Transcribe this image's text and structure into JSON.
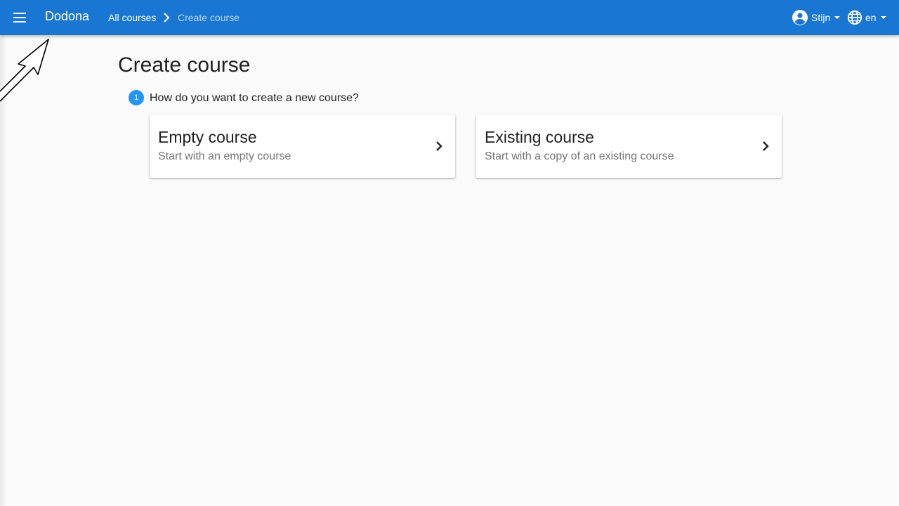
{
  "app": {
    "brand": "Dodona"
  },
  "breadcrumb": {
    "parent": "All courses",
    "current": "Create course"
  },
  "user_menu": {
    "name": "Stijn"
  },
  "lang_menu": {
    "code": "en"
  },
  "page": {
    "title": "Create course",
    "step_number": "1",
    "step_question": "How do you want to create a new course?"
  },
  "options": [
    {
      "title": "Empty course",
      "subtitle": "Start with an empty course"
    },
    {
      "title": "Existing course",
      "subtitle": "Start with a copy of an existing course"
    }
  ],
  "colors": {
    "appbar": "#1976d2",
    "step_badge": "#2196f3",
    "background": "#fafafa"
  },
  "icons": {
    "menu": "menu-icon",
    "breadcrumb_separator": "chevron-right-icon",
    "user": "account-circle-icon",
    "language": "globe-icon",
    "dropdown": "caret-down-icon",
    "card_arrow": "chevron-right-icon"
  }
}
